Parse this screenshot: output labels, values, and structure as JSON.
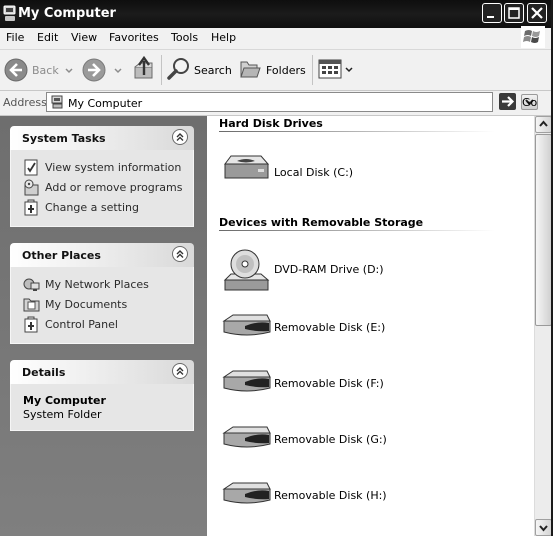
{
  "window": {
    "title": "My Computer"
  },
  "menubar": {
    "items": [
      "File",
      "Edit",
      "View",
      "Favorites",
      "Tools",
      "Help"
    ]
  },
  "toolbar": {
    "back_label": "Back",
    "search_label": "Search",
    "folders_label": "Folders"
  },
  "address": {
    "label": "Address",
    "value": "My Computer",
    "go_label": "Go"
  },
  "sidebar": {
    "system_tasks": {
      "title": "System Tasks",
      "items": [
        {
          "label": "View system information",
          "icon": "system-info-icon"
        },
        {
          "label": "Add or remove programs",
          "icon": "add-remove-programs-icon"
        },
        {
          "label": "Change a setting",
          "icon": "control-panel-icon"
        }
      ]
    },
    "other_places": {
      "title": "Other Places",
      "items": [
        {
          "label": "My Network Places",
          "icon": "network-places-icon"
        },
        {
          "label": "My Documents",
          "icon": "documents-folder-icon"
        },
        {
          "label": "Control Panel",
          "icon": "control-panel-icon"
        }
      ]
    },
    "details": {
      "title": "Details",
      "name": "My Computer",
      "type": "System Folder"
    }
  },
  "content": {
    "groups": [
      {
        "title": "Hard Disk Drives",
        "items": [
          {
            "label": "Local Disk (C:)",
            "icon": "hard-disk-icon"
          }
        ]
      },
      {
        "title": "Devices with Removable Storage",
        "items": [
          {
            "label": "DVD-RAM Drive (D:)",
            "icon": "dvd-drive-icon"
          },
          {
            "label": "Removable Disk (E:)",
            "icon": "removable-disk-icon"
          },
          {
            "label": "Removable Disk (F:)",
            "icon": "removable-disk-icon"
          },
          {
            "label": "Removable Disk (G:)",
            "icon": "removable-disk-icon"
          },
          {
            "label": "Removable Disk (H:)",
            "icon": "removable-disk-icon"
          }
        ]
      }
    ]
  }
}
